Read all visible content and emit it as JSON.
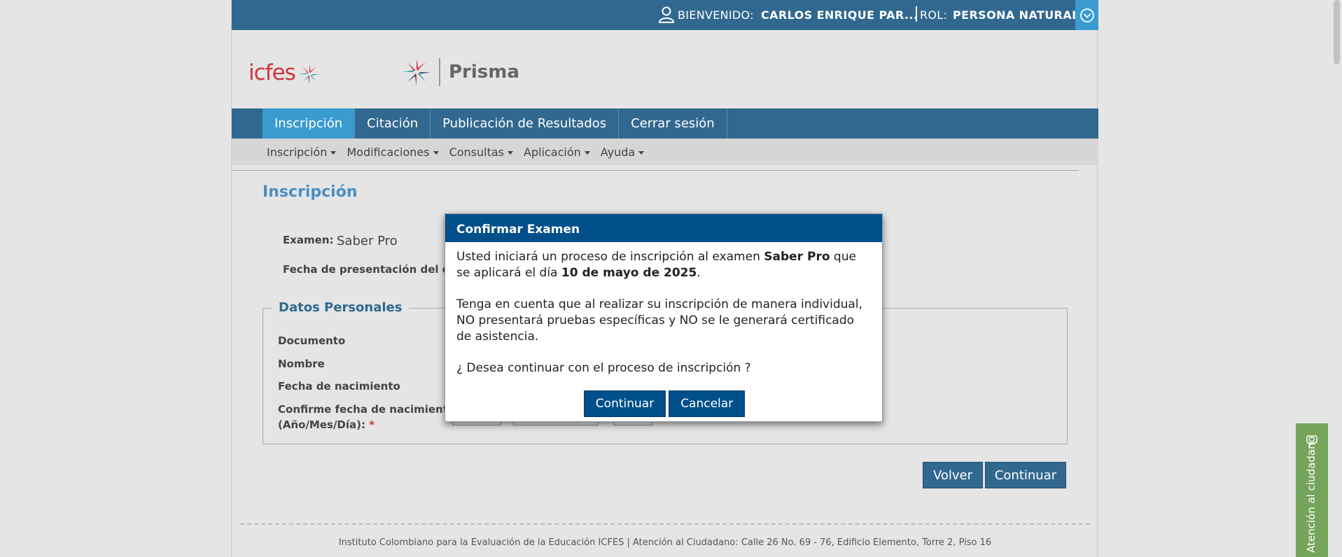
{
  "userbar": {
    "welcome_label": "BIENVENIDO:",
    "username": "CARLOS ENRIQUE PAR...",
    "rol_label": "ROL:",
    "rol_value": "PERSONA NATURAL"
  },
  "logos": {
    "icfes_text": "icfes",
    "prisma_text": "Prisma"
  },
  "mainnav": {
    "tabs": [
      {
        "label": "Inscripción",
        "active": true
      },
      {
        "label": "Citación"
      },
      {
        "label": "Publicación de Resultados"
      },
      {
        "label": "Cerrar sesión"
      }
    ]
  },
  "subnav": {
    "items": [
      {
        "label": "Inscripción"
      },
      {
        "label": "Modificaciones"
      },
      {
        "label": "Consultas"
      },
      {
        "label": "Aplicación"
      },
      {
        "label": "Ayuda"
      }
    ]
  },
  "main": {
    "title": "Inscripción",
    "exam_label": "Examen:",
    "exam_value": "Saber Pro",
    "fecha_label": "Fecha de presentación del examen",
    "personal": {
      "legend": "Datos Personales",
      "documento_label": "Documento",
      "nombre_label": "Nombre",
      "nacimiento_label": "Fecha de nacimiento",
      "confirme_label_line1": "Confirme fecha de nacimiento",
      "confirme_label_line2": "(Año/Mes/Día):",
      "required_mark": "*"
    },
    "volver_label": "Volver",
    "continuar_label": "Continuar"
  },
  "modal": {
    "title": "Confirmar Examen",
    "p1_prefix": "Usted iniciará un proceso de inscripción al examen ",
    "p1_exam": "Saber Pro",
    "p1_middle": " que se aplicará el día ",
    "p1_date": "10 de mayo de 2025",
    "p1_suffix": ".",
    "p2": "Tenga en cuenta que al realizar su inscripción de manera individual, NO presentará pruebas específicas y NO se le generará certificado de asistencia.",
    "p3": "¿ Desea continuar con el proceso de inscripción ?",
    "continuar_label": "Continuar",
    "cancelar_label": "Cancelar"
  },
  "footer": {
    "line1": "Instituto Colombiano para la Evaluación de la Educación ICFES   |   Atención al Ciudadano: Calle 26 No. 69 - 76, Edificio Elemento, Torre 2, Piso 16"
  },
  "atencion": {
    "label": "Atención al ciudadano"
  },
  "colors": {
    "nav_blue": "#31688f",
    "active_tab": "#3a9bd1",
    "modal_blue": "#004f8b",
    "title_blue": "#4a8ec2",
    "atencion_green": "#74a55a",
    "required_red": "#d0343e"
  }
}
